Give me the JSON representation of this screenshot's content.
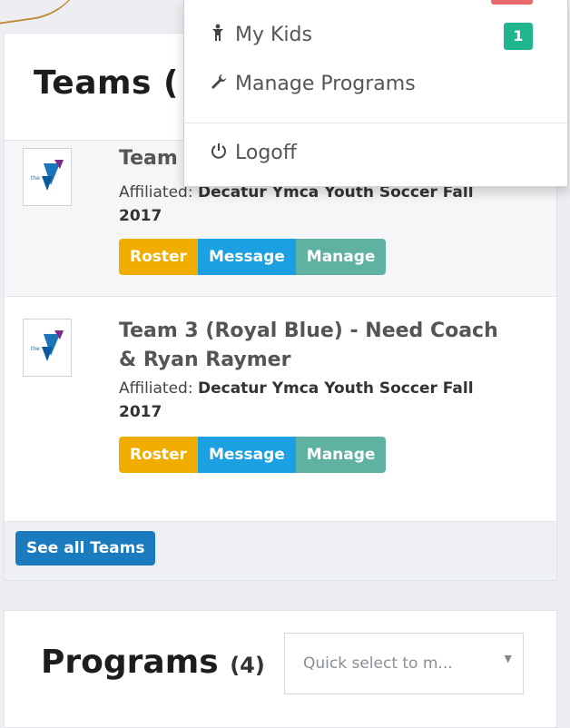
{
  "menu": {
    "my_kids": "My Kids",
    "my_kids_count": "1",
    "manage_programs": "Manage Programs",
    "logoff": "Logoff"
  },
  "teams": {
    "title": "Teams (",
    "rows": [
      {
        "name": "Team",
        "affiliation_label": "Affiliated:",
        "affiliation": "Decatur Ymca Youth Soccer Fall",
        "year": "2017",
        "roster": "Roster",
        "message": "Message",
        "manage": "Manage"
      },
      {
        "name_line1": "Team 3 (Royal Blue) - Need Coach",
        "name_line2": "& Ryan Raymer",
        "affiliation_label": "Affiliated:",
        "affiliation": "Decatur Ymca Youth Soccer Fall",
        "year": "2017",
        "roster": "Roster",
        "message": "Message",
        "manage": "Manage"
      }
    ],
    "see_all": "See all Teams"
  },
  "programs": {
    "title": "Programs",
    "count": "(4)",
    "quick_select_placeholder": "Quick select to m..."
  },
  "colors": {
    "roster": "#f0ad00",
    "message": "#1ba1e2",
    "manage": "#5fb1a2",
    "see_all": "#1a7bbf",
    "badge_green": "#1fb58f"
  }
}
